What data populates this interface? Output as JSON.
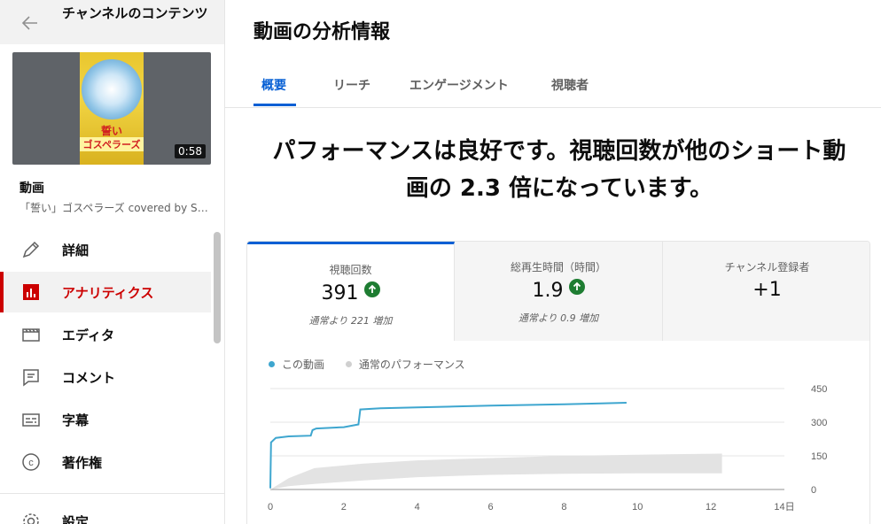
{
  "sidebar": {
    "title": "チャンネルのコンテンツ",
    "video_label": "動画",
    "video_title": "「誓い」ゴスペラーズ covered by St...",
    "thumbnail": {
      "duration": "0:58",
      "text1": "誓い",
      "text2": "ゴスペラーズ"
    },
    "items": [
      {
        "label": "詳細",
        "icon": "pencil-icon"
      },
      {
        "label": "アナリティクス",
        "icon": "analytics-icon",
        "active": true
      },
      {
        "label": "エディタ",
        "icon": "editor-icon"
      },
      {
        "label": "コメント",
        "icon": "comment-icon"
      },
      {
        "label": "字幕",
        "icon": "subtitles-icon"
      },
      {
        "label": "著作権",
        "icon": "copyright-icon"
      },
      {
        "label": "設定",
        "icon": "gear-icon"
      }
    ]
  },
  "main": {
    "title": "動画の分析情報",
    "tabs": [
      {
        "label": "概要",
        "active": true
      },
      {
        "label": "リーチ"
      },
      {
        "label": "エンゲージメント"
      },
      {
        "label": "視聴者"
      }
    ],
    "headline_line1": "パフォーマンスは良好です。視聴回数が他のショート動",
    "headline_line2": "画の 2.3 倍になっています。",
    "metrics": [
      {
        "label": "視聴回数",
        "value": "391",
        "sub": "通常より 221 増加",
        "trend": "up"
      },
      {
        "label": "総再生時間（時間）",
        "value": "1.9",
        "sub": "通常より 0.9 増加",
        "trend": "up"
      },
      {
        "label": "チャンネル登録者",
        "value": "+1"
      }
    ]
  },
  "colors": {
    "accent": "#065fd4",
    "active_red": "#cc0000",
    "this_video": "#3ea6cf",
    "typical": "#e3e3e3",
    "trend_up": "#1e7d32"
  },
  "chart_data": {
    "type": "line",
    "legend": [
      "この動画",
      "通常のパフォーマンス"
    ],
    "x_ticks": [
      "0",
      "2",
      "4",
      "6",
      "8",
      "10",
      "12",
      "14日"
    ],
    "y_ticks": [
      "0",
      "150",
      "300",
      "450"
    ],
    "xlim": [
      0,
      14
    ],
    "ylim": [
      0,
      450
    ],
    "series": [
      {
        "name": "この動画",
        "color": "#3ea6cf",
        "x": [
          0,
          0.02,
          0.15,
          0.5,
          1.1,
          1.15,
          1.25,
          2.0,
          2.4,
          2.45,
          3.0,
          4.0,
          5.0,
          6.0,
          7.0,
          8.0,
          9.0,
          9.7
        ],
        "y": [
          5,
          210,
          230,
          237,
          240,
          265,
          272,
          278,
          290,
          357,
          362,
          366,
          370,
          374,
          377,
          380,
          384,
          387
        ]
      },
      {
        "name": "通常のパフォーマンス",
        "color": "#e3e3e3",
        "x": [
          0,
          0.5,
          1.2,
          2.5,
          4,
          6,
          8,
          10,
          12.3
        ],
        "low": [
          0,
          15,
          25,
          40,
          55,
          65,
          70,
          72,
          72
        ],
        "high": [
          0,
          50,
          95,
          115,
          130,
          140,
          150,
          155,
          160
        ]
      }
    ]
  }
}
